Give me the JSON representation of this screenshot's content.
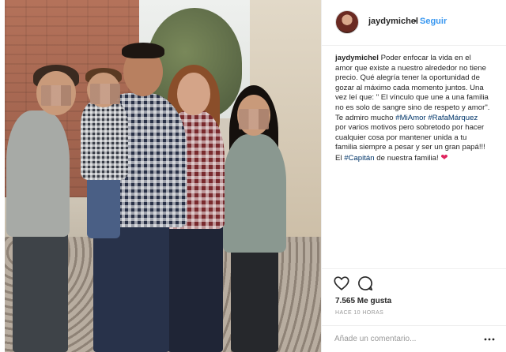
{
  "post": {
    "author": {
      "username": "jaydymichel",
      "separator": "•",
      "follow_label": "Seguir"
    },
    "caption": {
      "username": "jaydymichel",
      "segments": [
        {
          "type": "text",
          "value": " Poder enfocar la vida en el amor que existe a nuestro alrededor no tiene precio. Qué alegría tener la oportunidad de gozar al máximo cada momento juntos. Una vez leí que: \" El vínculo que une a una familia no es solo de sangre sino de respeto y amor\". Te admiro mucho "
        },
        {
          "type": "tag",
          "value": "#MiAmor"
        },
        {
          "type": "text",
          "value": " "
        },
        {
          "type": "tag",
          "value": "#RafaMárquez"
        },
        {
          "type": "text",
          "value": " por varios motivos pero sobretodo por hacer cualquier cosa por mantener unida a tu familia siempre a pesar y ser un gran papá!!! El "
        },
        {
          "type": "tag",
          "value": "#Capitán"
        },
        {
          "type": "text",
          "value": " de nuestra familia! "
        },
        {
          "type": "emoji",
          "value": "❤"
        }
      ]
    },
    "likes_text": "7.565 Me gusta",
    "time_text": "HACE 10 HORAS",
    "comment": {
      "placeholder": "Añade un comentario...",
      "value": ""
    },
    "icons": {
      "like": "heart-outline-icon",
      "comment": "speech-bubble-icon",
      "more": "ellipsis-icon"
    },
    "colors": {
      "link_blue": "#3897f0",
      "hashtag": "#003569",
      "text": "#262626",
      "muted": "#999999",
      "heart": "#e0245e"
    }
  }
}
